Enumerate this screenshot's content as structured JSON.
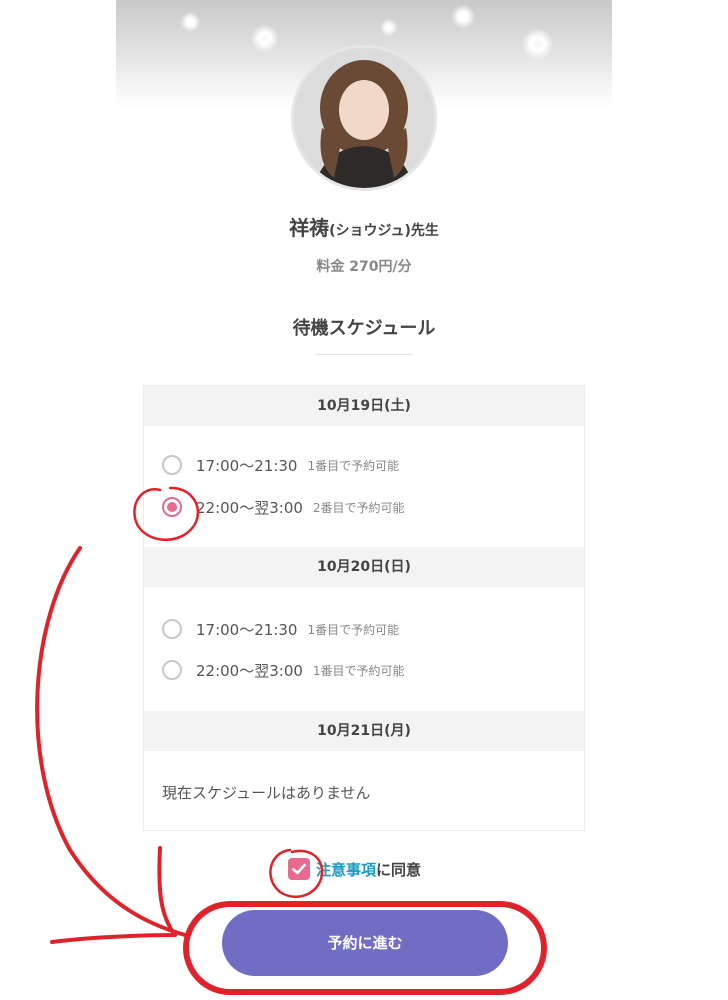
{
  "teacher": {
    "name": "祥祷",
    "kana": "(ショウジュ)",
    "honorific": "先生",
    "price": "料金 270円/分"
  },
  "schedule": {
    "title": "待機スケジュール",
    "days": [
      {
        "date": "10月19日(土)",
        "slots": [
          {
            "time": "17:00〜21:30",
            "note": "1番目で予約可能",
            "selected": false
          },
          {
            "time": "22:00〜翌3:00",
            "note": "2番目で予約可能",
            "selected": true
          }
        ]
      },
      {
        "date": "10月20日(日)",
        "slots": [
          {
            "time": "17:00〜21:30",
            "note": "1番目で予約可能",
            "selected": false
          },
          {
            "time": "22:00〜翌3:00",
            "note": "1番目で予約可能",
            "selected": false
          }
        ]
      },
      {
        "date": "10月21日(月)",
        "empty": "現在スケジュールはありません"
      }
    ]
  },
  "agreement": {
    "link": "注意事項",
    "text": "に同意",
    "checked": true
  },
  "cta": {
    "label": "予約に進む"
  },
  "colors": {
    "accent_pink": "#e86a8f",
    "button_purple": "#6f6ec4",
    "link_blue": "#1a9dc2",
    "annotation_red": "#e0232b"
  }
}
